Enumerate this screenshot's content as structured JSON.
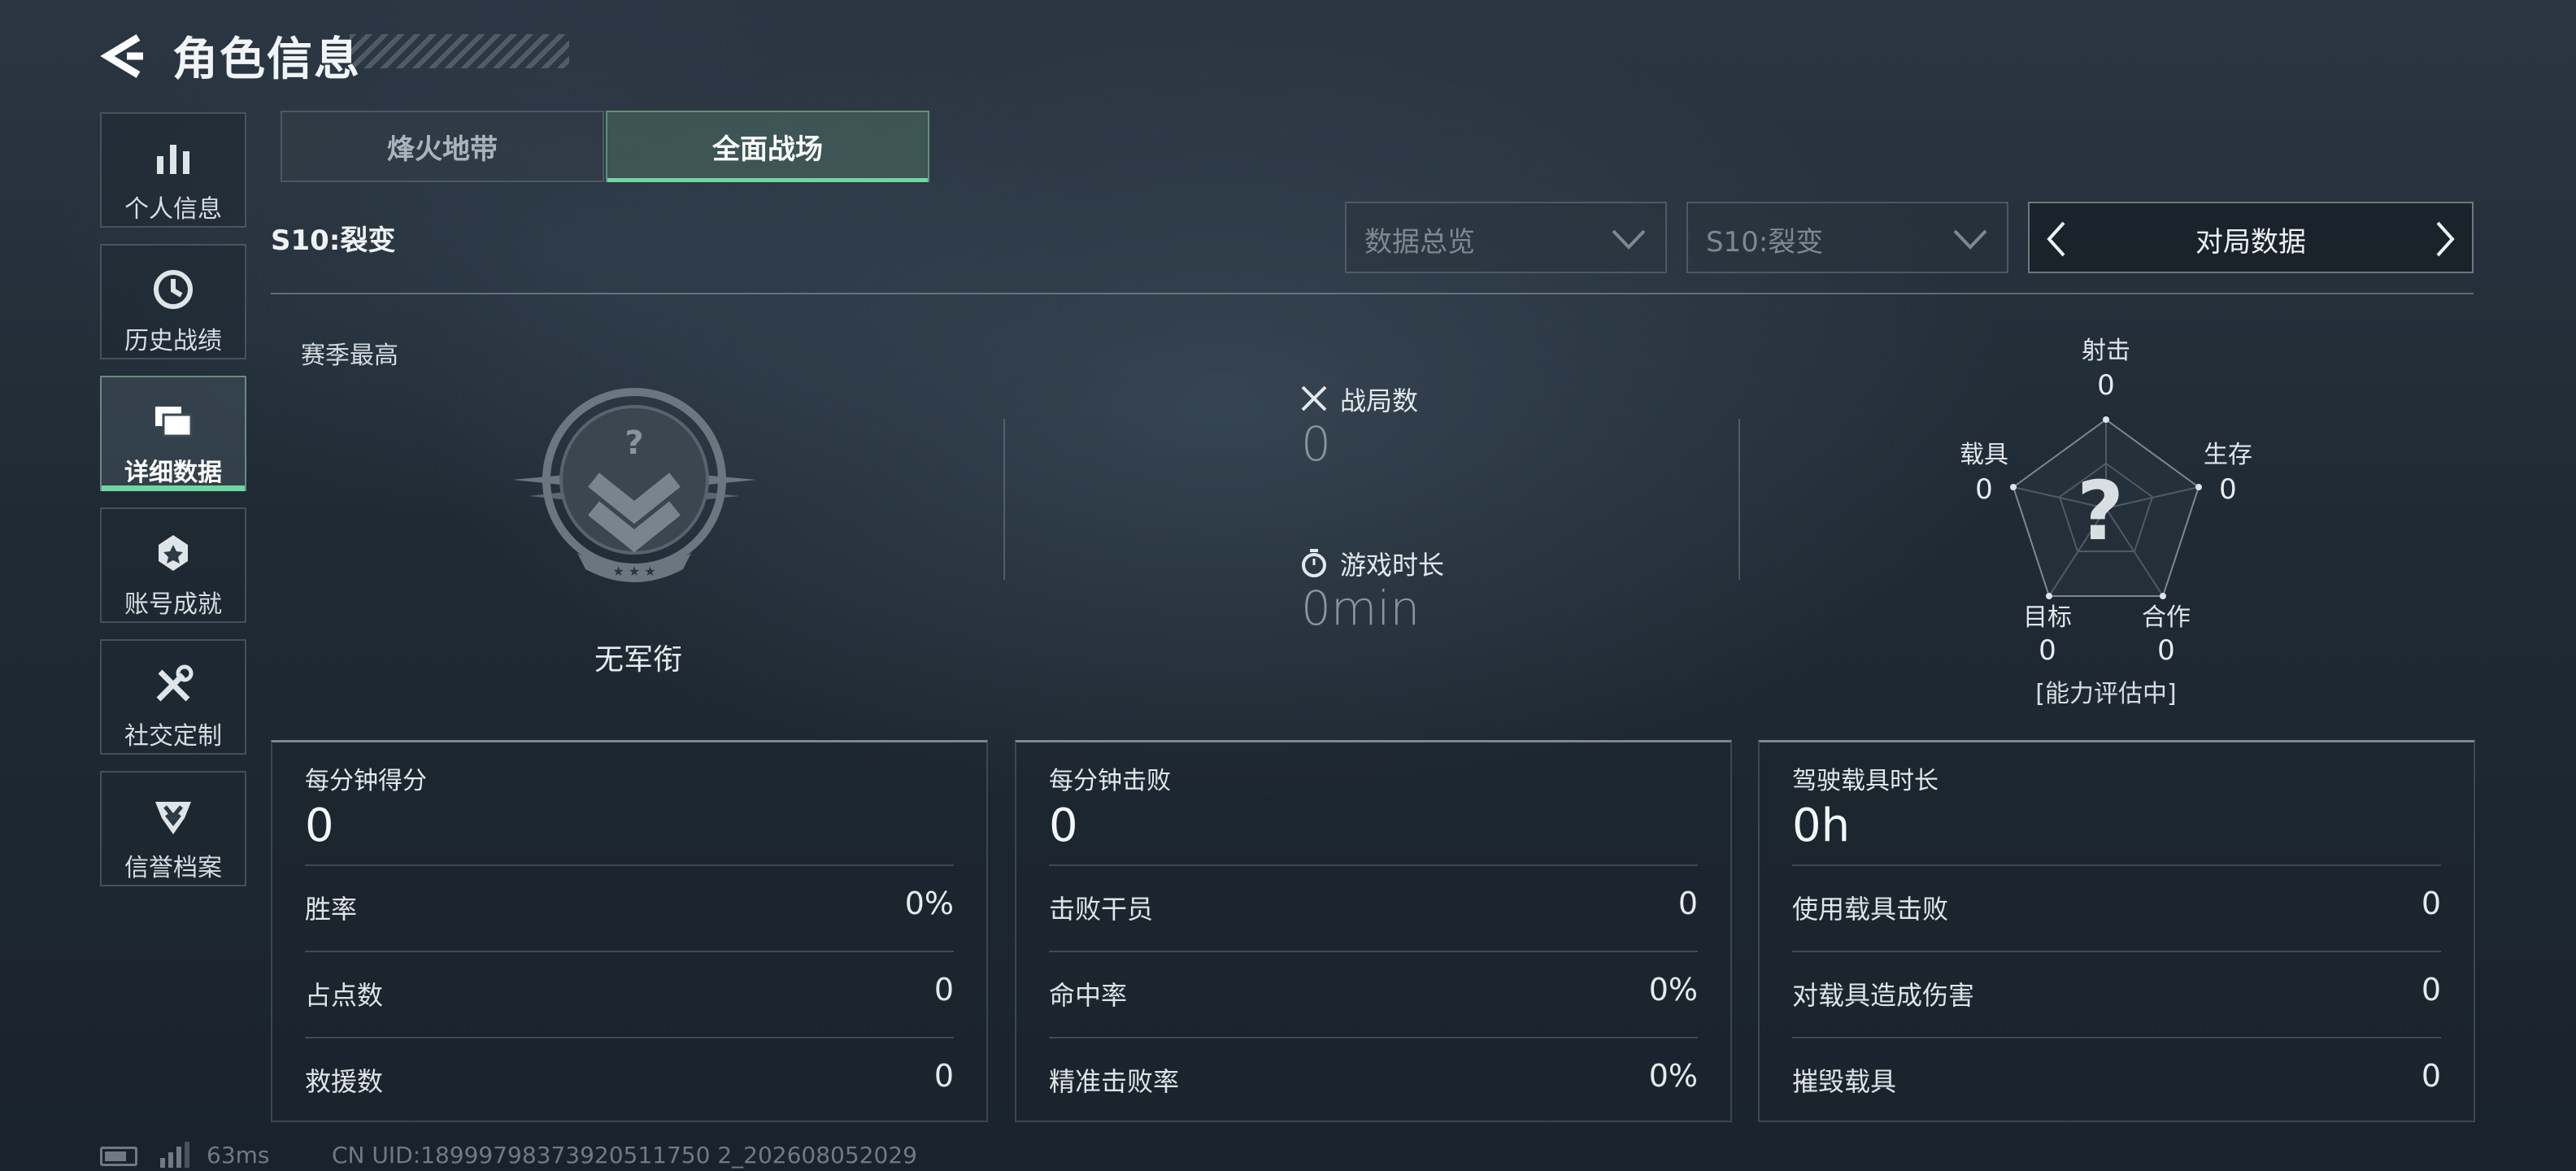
{
  "header": {
    "title": "角色信息",
    "back_icon": "chevron-left-icon"
  },
  "sidebar": {
    "items": [
      {
        "label": "个人信息",
        "icon": "bar-chart-icon",
        "active": false
      },
      {
        "label": "历史战绩",
        "icon": "history-clock-icon",
        "active": false
      },
      {
        "label": "详细数据",
        "icon": "folders-icon",
        "active": true
      },
      {
        "label": "账号成就",
        "icon": "achievement-icon",
        "active": false
      },
      {
        "label": "社交定制",
        "icon": "tools-icon",
        "active": false
      },
      {
        "label": "信誉档案",
        "icon": "shield-rank-icon",
        "active": false
      }
    ]
  },
  "mode_tabs": [
    {
      "label": "烽火地带",
      "active": false
    },
    {
      "label": "全面战场",
      "active": true
    }
  ],
  "season": {
    "label": "S10:裂变"
  },
  "filters": {
    "overview": {
      "value": "数据总览"
    },
    "season": {
      "value": "S10:裂变"
    },
    "pager": {
      "value": "对局数据"
    }
  },
  "rank": {
    "section_label": "赛季最高",
    "name": "无军衔",
    "emblem_icon": "rank-unknown-emblem-icon"
  },
  "stats": {
    "matches": {
      "label": "战局数",
      "value": "0",
      "icon": "crossed-swords-icon"
    },
    "playtime": {
      "label": "游戏时长",
      "value": "0min",
      "icon": "stopwatch-icon"
    }
  },
  "radar": {
    "axes": [
      {
        "label": "射击",
        "value": "0"
      },
      {
        "label": "生存",
        "value": "0"
      },
      {
        "label": "合作",
        "value": "0"
      },
      {
        "label": "目标",
        "value": "0"
      },
      {
        "label": "载具",
        "value": "0"
      }
    ],
    "center": "?",
    "note": "[能力评估中]"
  },
  "panels": [
    {
      "title": "每分钟得分",
      "value": "0",
      "rows": [
        {
          "label": "胜率",
          "value": "0%"
        },
        {
          "label": "占点数",
          "value": "0"
        },
        {
          "label": "救援数",
          "value": "0"
        }
      ]
    },
    {
      "title": "每分钟击败",
      "value": "0",
      "rows": [
        {
          "label": "击败干员",
          "value": "0"
        },
        {
          "label": "命中率",
          "value": "0%"
        },
        {
          "label": "精准击败率",
          "value": "0%"
        }
      ]
    },
    {
      "title": "驾驶载具时长",
      "value": "0h",
      "rows": [
        {
          "label": "使用载具击败",
          "value": "0"
        },
        {
          "label": "对载具造成伤害",
          "value": "0"
        },
        {
          "label": "摧毁载具",
          "value": "0"
        }
      ]
    }
  ],
  "status_bar": {
    "ping": "63ms",
    "uid": "CN UID:18999798373920511750 2_202608052029"
  },
  "colors": {
    "accent": "#6fd7a2",
    "background": "#1f2a34"
  }
}
